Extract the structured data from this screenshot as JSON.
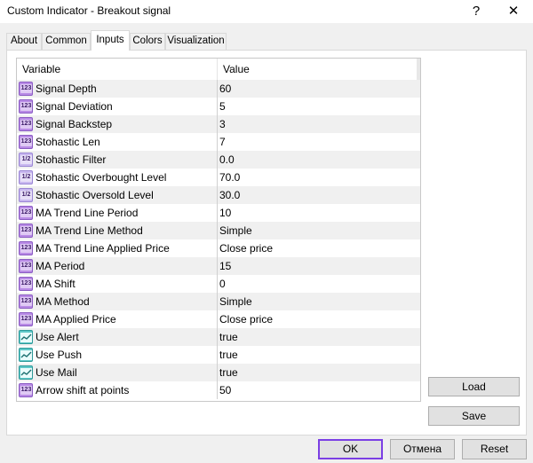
{
  "window": {
    "title": "Custom Indicator - Breakout signal",
    "help_glyph": "?",
    "close_glyph": "✕"
  },
  "tabs": [
    {
      "label": "About"
    },
    {
      "label": "Common"
    },
    {
      "label": "Inputs"
    },
    {
      "label": "Colors"
    },
    {
      "label": "Visualization"
    }
  ],
  "active_tab": "Inputs",
  "grid": {
    "headers": {
      "variable": "Variable",
      "value": "Value"
    },
    "rows": [
      {
        "icon": "int-icon",
        "icon_text": "123",
        "name": "Signal Depth",
        "value": "60"
      },
      {
        "icon": "int-icon",
        "icon_text": "123",
        "name": "Signal Deviation",
        "value": "5"
      },
      {
        "icon": "int-icon",
        "icon_text": "123",
        "name": "Signal Backstep",
        "value": "3"
      },
      {
        "icon": "int-icon",
        "icon_text": "123",
        "name": "Stohastic Len",
        "value": "7"
      },
      {
        "icon": "double-icon",
        "icon_text": "1/2",
        "name": "Stohastic Filter",
        "value": "0.0"
      },
      {
        "icon": "double-icon",
        "icon_text": "1/2",
        "name": "Stohastic Overbought Level",
        "value": "70.0"
      },
      {
        "icon": "double-icon",
        "icon_text": "1/2",
        "name": "Stohastic Oversold Level",
        "value": "30.0"
      },
      {
        "icon": "int-icon",
        "icon_text": "123",
        "name": "MA Trend Line Period",
        "value": "10"
      },
      {
        "icon": "int-icon",
        "icon_text": "123",
        "name": "MA Trend Line Method",
        "value": "Simple"
      },
      {
        "icon": "int-icon",
        "icon_text": "123",
        "name": "MA Trend Line Applied Price",
        "value": "Close price"
      },
      {
        "icon": "int-icon",
        "icon_text": "123",
        "name": "MA Period",
        "value": "15"
      },
      {
        "icon": "int-icon",
        "icon_text": "123",
        "name": "MA Shift",
        "value": "0"
      },
      {
        "icon": "int-icon",
        "icon_text": "123",
        "name": "MA Method",
        "value": "Simple"
      },
      {
        "icon": "int-icon",
        "icon_text": "123",
        "name": "MA Applied Price",
        "value": "Close price"
      },
      {
        "icon": "bool-icon",
        "icon_text": "",
        "name": "Use Alert",
        "value": "true"
      },
      {
        "icon": "bool-icon",
        "icon_text": "",
        "name": "Use Push",
        "value": "true"
      },
      {
        "icon": "bool-icon",
        "icon_text": "",
        "name": "Use Mail",
        "value": "true"
      },
      {
        "icon": "int-icon",
        "icon_text": "123",
        "name": "Arrow shift at points",
        "value": "50"
      }
    ]
  },
  "side_buttons": {
    "load": "Load",
    "save": "Save"
  },
  "footer_buttons": {
    "ok": "OK",
    "cancel": "Отмена",
    "reset": "Reset"
  },
  "colors": {
    "ok_focus_border": "#7b3fe4",
    "int_icon": "#b98be6",
    "double_icon": "#c9b8f0",
    "bool_icon": "#5fc8c8"
  }
}
